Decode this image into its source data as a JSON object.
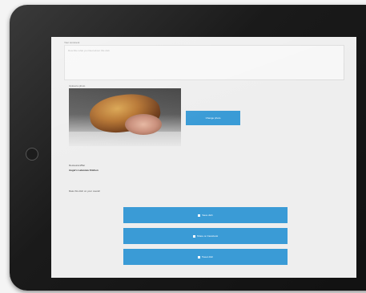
{
  "form": {
    "description_label": "Your comment",
    "description_placeholder": "Describe what you liked about this dish",
    "photo_label": "Upload a photo",
    "change_photo_button": "Change photo",
    "restaurant_label": "Restaurant/Bar",
    "restaurant_value": "Augie's Lakeview Kitchen",
    "rating_label": "Rate this dish on your overall",
    "actions": {
      "save_label": "Save dish",
      "facebook_label": "Share on Facebook",
      "twitter_label": "Tweet dish"
    }
  },
  "colors": {
    "accent": "#3a9bd6",
    "device": "#1a1a1a",
    "screen_bg": "#eeeeee"
  }
}
